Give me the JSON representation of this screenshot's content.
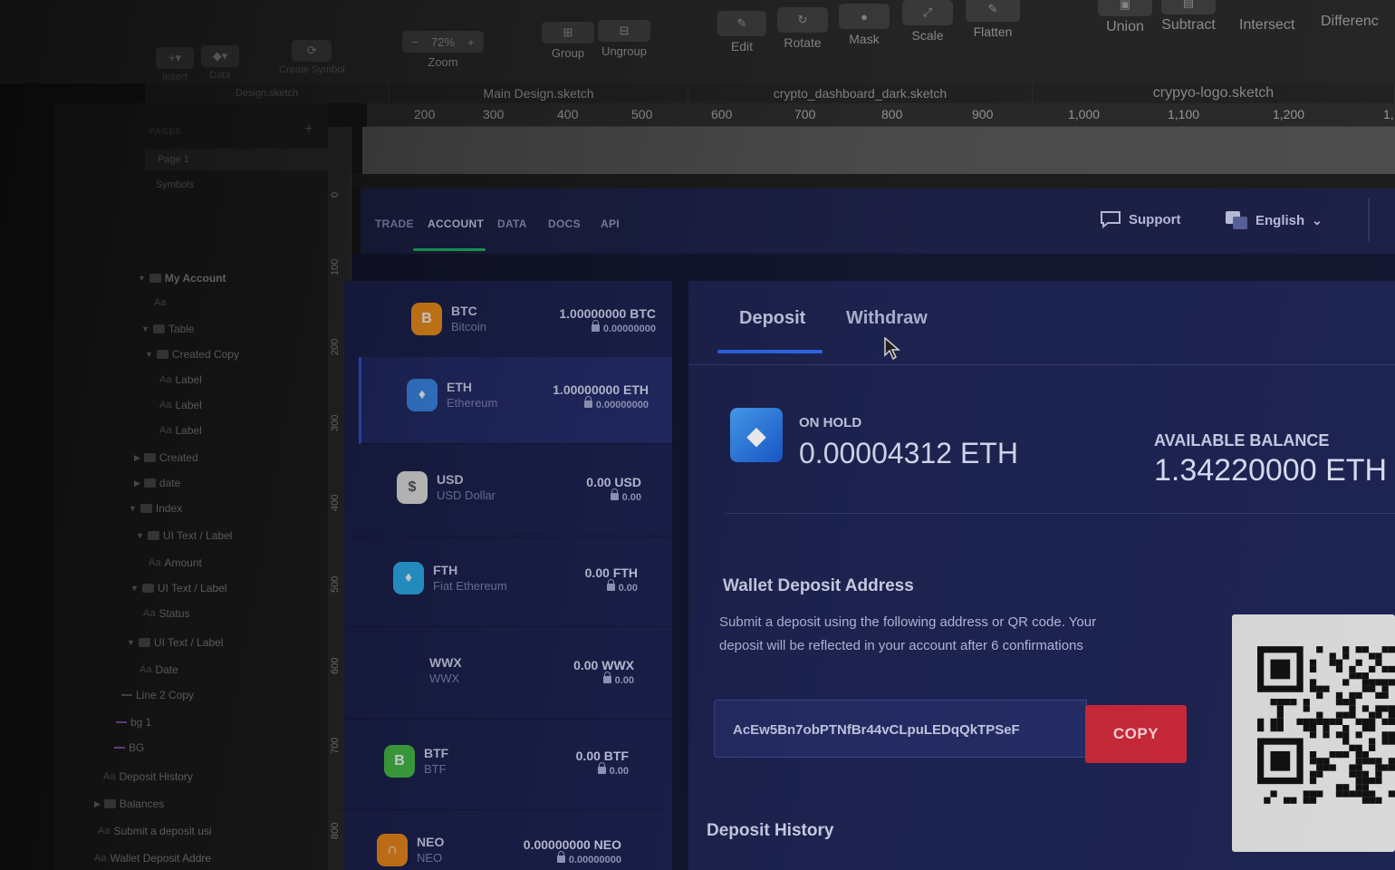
{
  "toolbar": {
    "insert": "Insert",
    "data": "Data",
    "create_symbol": "Create Symbol",
    "zoom_value": "72%",
    "zoom": "Zoom",
    "group": "Group",
    "ungroup": "Ungroup",
    "edit": "Edit",
    "rotate": "Rotate",
    "mask": "Mask",
    "scale": "Scale",
    "flatten": "Flatten",
    "union": "Union",
    "subtract": "Subtract",
    "intersect": "Intersect",
    "difference": "Differenc"
  },
  "file_tabs": [
    "Design.sketch",
    "Main Design.sketch",
    "crypto_dashboard_dark.sketch",
    "crypyo-logo.sketch"
  ],
  "ruler_top": [
    "200",
    "300",
    "400",
    "500",
    "600",
    "700",
    "800",
    "900",
    "1,000",
    "1,100",
    "1,200",
    "1,"
  ],
  "ruler_left": [
    "0",
    "100",
    "200",
    "300",
    "400",
    "500",
    "600",
    "700",
    "800"
  ],
  "sidebar": {
    "pages_header": "PAGES",
    "pages": [
      "Page 1",
      "Symbols"
    ],
    "layers": [
      {
        "label": "My Account",
        "kind": "artboard"
      },
      {
        "label": "",
        "kind": "text"
      },
      {
        "label": "Table",
        "kind": "group"
      },
      {
        "label": "Created Copy",
        "kind": "group"
      },
      {
        "label": "Label",
        "kind": "text"
      },
      {
        "label": "Label",
        "kind": "text"
      },
      {
        "label": "Label",
        "kind": "text"
      },
      {
        "label": "Created",
        "kind": "group-collapsed"
      },
      {
        "label": "date",
        "kind": "group-collapsed"
      },
      {
        "label": "Index",
        "kind": "group"
      },
      {
        "label": "UI Text / Label",
        "kind": "group"
      },
      {
        "label": "Amount",
        "kind": "text"
      },
      {
        "label": "UI Text / Label",
        "kind": "group"
      },
      {
        "label": "Status",
        "kind": "text"
      },
      {
        "label": "UI Text / Label",
        "kind": "group"
      },
      {
        "label": "Date",
        "kind": "text"
      },
      {
        "label": "Line 2 Copy",
        "kind": "line"
      },
      {
        "label": "bg 1",
        "kind": "line-pink"
      },
      {
        "label": "BG",
        "kind": "line-pink"
      },
      {
        "label": "Deposit History",
        "kind": "text"
      },
      {
        "label": "Balances",
        "kind": "group-collapsed"
      },
      {
        "label": "Submit a deposit usi",
        "kind": "text"
      },
      {
        "label": "Wallet Deposit Addre",
        "kind": "text"
      }
    ]
  },
  "app": {
    "nav": [
      "TRADE",
      "ACCOUNT",
      "DATA",
      "DOCS",
      "API"
    ],
    "active_nav": "ACCOUNT",
    "support": "Support",
    "language": "English",
    "coins": [
      {
        "symbol": "BTC",
        "name": "Bitcoin",
        "balance": "1.00000000 BTC",
        "hold": "0.00000000",
        "logo": "B",
        "color": "#f7931a"
      },
      {
        "symbol": "ETH",
        "name": "Ethereum",
        "balance": "1.00000000 ETH",
        "hold": "0.00000000",
        "logo": "♦",
        "color": "#3c8cf0",
        "selected": true
      },
      {
        "symbol": "USD",
        "name": "USD Dollar",
        "balance": "0.00 USD",
        "hold": "0.00",
        "logo": "$",
        "color": "#e8e8e8"
      },
      {
        "symbol": "FTH",
        "name": "Fiat Ethereum",
        "balance": "0.00 FTH",
        "hold": "0.00",
        "logo": "♦",
        "color": "#2fb3f5"
      },
      {
        "symbol": "WWX",
        "name": "WWX",
        "balance": "0.00 WWX",
        "hold": "0.00",
        "logo": "",
        "color": "transparent"
      },
      {
        "symbol": "BTF",
        "name": "BTF",
        "balance": "0.00 BTF",
        "hold": "0.00",
        "logo": "B",
        "color": "#48c04a"
      },
      {
        "symbol": "NEO",
        "name": "NEO",
        "balance": "0.00000000 NEO",
        "hold": "0.00000000",
        "logo": "∩",
        "color": "#f08a1c"
      }
    ],
    "tabs": [
      "Deposit",
      "Withdraw"
    ],
    "active_tab": "Deposit",
    "on_hold_label": "ON HOLD",
    "on_hold_value": "0.00004312 ETH",
    "available_label": "AVAILABLE BALANCE",
    "available_value": "1.34220000 ETH",
    "wallet_title": "Wallet Deposit Address",
    "wallet_desc": "Submit a deposit using the following address or QR code. Your deposit will be reflected in your account after 6 confirmations",
    "address": "AcEw5Bn7obPTNfBr44vCLpuLEDqQkTPSeF",
    "copy_label": "COPY",
    "deposit_history": "Deposit History"
  }
}
